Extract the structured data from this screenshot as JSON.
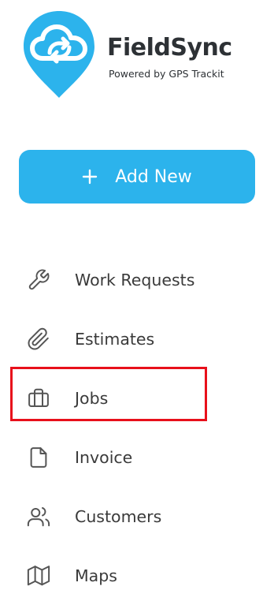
{
  "brand": {
    "name": "FieldSync",
    "tagline": "Powered by GPS Trackit",
    "logo_icon": "cloud-sync-pin-icon",
    "accent_color": "#2cb3ec"
  },
  "add_new": {
    "label": "Add New",
    "icon": "plus-icon"
  },
  "nav": {
    "items": [
      {
        "label": "Work Requests",
        "icon": "wrench-icon"
      },
      {
        "label": "Estimates",
        "icon": "paperclip-icon"
      },
      {
        "label": "Jobs",
        "icon": "briefcase-icon",
        "highlighted": true
      },
      {
        "label": "Invoice",
        "icon": "document-icon"
      },
      {
        "label": "Customers",
        "icon": "users-icon"
      },
      {
        "label": "Maps",
        "icon": "map-icon"
      }
    ]
  },
  "highlight_color": "#e8101b"
}
